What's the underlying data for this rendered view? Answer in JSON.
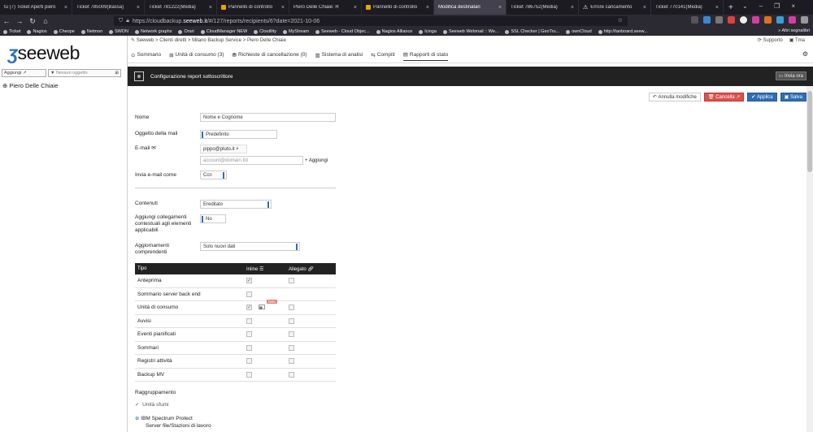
{
  "browser": {
    "tabs": [
      {
        "label": "tu (7) Ticket Aperti piero"
      },
      {
        "label": "Ticket 785009(Bassa)"
      },
      {
        "label": "Ticket 781222(Media)"
      },
      {
        "label": "Pannello di controllo"
      },
      {
        "label": "Piero Delle Chiaie: R"
      },
      {
        "label": "Pannello di controllo"
      },
      {
        "label": "Modifica destinatari"
      },
      {
        "label": "Ticket 786752(Media)"
      },
      {
        "label": "Errore caricamento"
      },
      {
        "label": "Ticket 770141(Media)"
      }
    ],
    "active_tab": 6,
    "url_prefix": "https://cloudbackup.",
    "url_domain": "seeweb.it",
    "url_suffix": "/#/127/reports/recipients/6?date=2021-10-06",
    "bookmarks": [
      "Ticket",
      "Nagios",
      "Cheope",
      "Netmon",
      "SWDN",
      "Network graphs",
      "Orari",
      "CloudManager NEW",
      "Cloutility",
      "MyStream",
      "Seeweb - Cloud Objec...",
      "Nagios Alliance",
      "Icinga",
      "Seeweb Webmail :: We...",
      "SSL Checker | GeoTru...",
      "ownCloud",
      "http://tanboard.seew..."
    ],
    "bookmarks_more": "Altri segnalibri"
  },
  "sidebar": {
    "logo": "seeweb",
    "add_label": "Aggiungi",
    "filter_label": "Nessun oggetto",
    "tree_item": "Piero Delle Chiaie"
  },
  "header": {
    "breadcrumb": "Seeweb  >  Clienti diretti  >  Milano Backup Service  >  Piero Delle Chiaie",
    "support": "Supporto",
    "user": "Tma",
    "menu": [
      "Sommario",
      "Unità di consumo (3)",
      "Richieste di cancellazione (0)",
      "Sistema di analisi",
      "Compiti",
      "Rapporti di stato"
    ]
  },
  "panel": {
    "title": "Configurazione report sottoscrittore",
    "send_now": "Invia ora"
  },
  "actions": {
    "cancel": "Annulla modifiche",
    "delete": "Cancella",
    "apply": "Applica",
    "save": "Salva"
  },
  "form": {
    "name_label": "Nome",
    "name_value": "Nome e Cognome",
    "subject_label": "Oggetto della mail",
    "subject_value": "Predefinito",
    "email_label": "E-mail",
    "email_chip": "pippo@pluto.it",
    "email_placeholder": "account@domain.tld",
    "email_add": "+ Aggiungi",
    "send_as_label": "Invia e-mail come",
    "send_as_value": "Ccn",
    "content_label": "Contenuti",
    "content_value": "Ereditato",
    "links_label": "Aggiungi collegamenti contestuali agli elementi applicabili",
    "links_value": "No",
    "updates_label": "Aggiornamenti comprendenti",
    "updates_value": "Solo nuovi dati"
  },
  "table": {
    "col_type": "Tipo",
    "col_inline": "Inline",
    "col_attach": "Allegato",
    "badge": "beta",
    "rows": [
      {
        "name": "Anteprima",
        "inline": true
      },
      {
        "name": "Sommario server back end",
        "inline": false
      },
      {
        "name": "Unità di consumo",
        "inline": true
      },
      {
        "name": "Avvisi",
        "inline": false
      },
      {
        "name": "Eventi pianificati",
        "inline": false
      },
      {
        "name": "Sommari",
        "inline": false
      },
      {
        "name": "Registri attività",
        "inline": false
      },
      {
        "name": "Backup MV",
        "inline": false
      }
    ]
  },
  "grouping": {
    "label": "Raggruppamento",
    "option": "Unità sfumi",
    "ibm": "IBM Spectrum Protect",
    "ibm_sub": "Server file/Stazioni di lavoro"
  }
}
